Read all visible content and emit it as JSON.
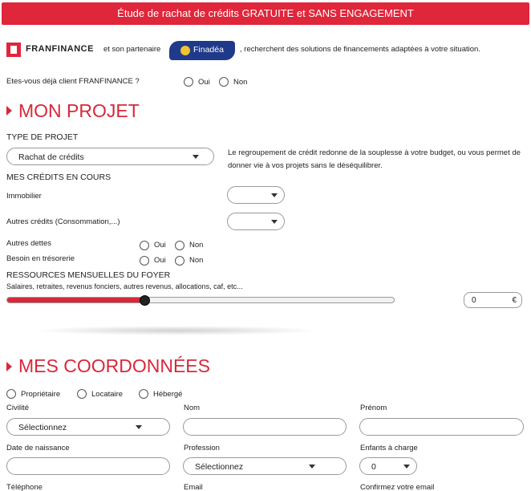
{
  "banner": "Étude de rachat de crédits GRATUITE et SANS ENGAGEMENT",
  "partners": {
    "franfinance_logo": "FRANFINANCE",
    "text1": "et son partenaire",
    "finadea_logo": "Finadéa",
    "text2": ", recherchent des solutions de financements adaptées à votre situation."
  },
  "client_question": {
    "label": "Etes-vous déjà client FRANFINANCE ?",
    "yes": "Oui",
    "no": "Non"
  },
  "projet": {
    "title": "MON PROJET",
    "type_label": "TYPE DE PROJET",
    "type_value": "Rachat de crédits",
    "description": "Le regroupement de crédit redonne de la souplesse à votre budget, ou vous permet de donner vie à vos projets sans le déséquilibrer.",
    "credits_title": "MES CRÉDITS EN COURS",
    "immobilier": "Immobilier",
    "autres_credits": "Autres crédits (Consommation,...)",
    "autres_dettes": "Autres dettes",
    "besoin_tresorerie": "Besoin en trésorerie",
    "yes": "Oui",
    "no": "Non",
    "ressources_title": "RESSOURCES MENSUELLES DU FOYER",
    "ressources_sub": "Salaires, retraites, revenus fonciers, autres revenus, allocations, caf, etc...",
    "ressources_value": "0",
    "currency": "€",
    "slider_fraction": 0.35,
    "slider_handle_symbol": "€"
  },
  "coordonnees": {
    "title": "MES COORDONNÉES",
    "proprietaire": "Propriétaire",
    "locataire": "Locataire",
    "heberge": "Hébergé",
    "civilite": "Civilité",
    "civilite_value": "Sélectionnez",
    "nom": "Nom",
    "prenom": "Prénom",
    "naissance": "Date de naissance",
    "profession": "Profession",
    "profession_value": "Sélectionnez",
    "enfants": "Enfants à charge",
    "enfants_value": "0",
    "telephone": "Téléphone",
    "email": "Email",
    "confirm_email": "Confirmez votre email"
  },
  "colors": {
    "accent": "#d8283a",
    "banner": "#e0263a",
    "finadea": "#1f3a8a"
  }
}
